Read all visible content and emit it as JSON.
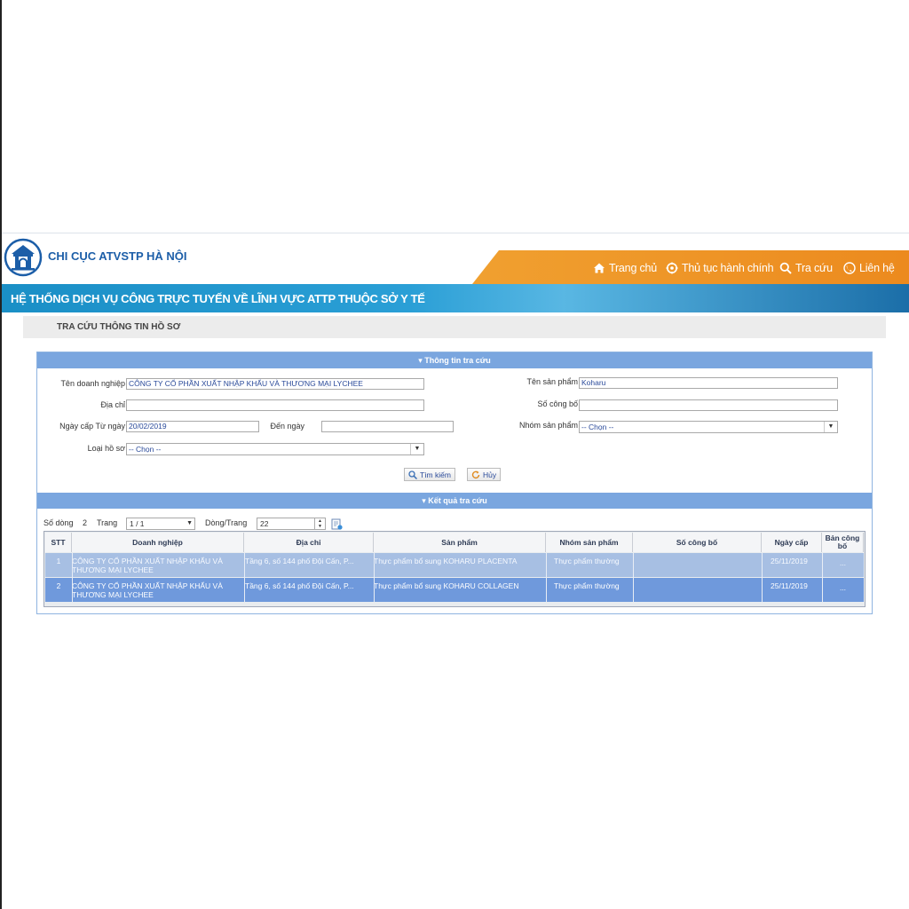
{
  "header": {
    "site_name": "CHI CỤC ATVSTP HÀ NỘI",
    "banner_title": "HỆ THỐNG DỊCH VỤ CÔNG TRỰC TUYẾN VỀ LĨNH VỰC ATTP THUỘC SỞ Y TẾ",
    "nav": [
      {
        "label": "Trang chủ",
        "icon": "home-icon"
      },
      {
        "label": "Thủ tục hành chính",
        "icon": "gear-icon"
      },
      {
        "label": "Tra cứu",
        "icon": "search-icon"
      },
      {
        "label": "Liên hệ",
        "icon": "phone-icon"
      }
    ]
  },
  "page_title": "TRA CỨU THÔNG TIN HỒ SƠ",
  "search": {
    "section_title": "Thông tin tra cứu",
    "company_label": "Tên doanh nghiệp",
    "company_value": "CÔNG TY CỔ PHẦN XUẤT NHẬP KHẨU VÀ THƯƠNG MẠI LYCHEE",
    "address_label": "Địa chỉ",
    "address_value": "",
    "date_from_label": "Ngày cấp Từ ngày",
    "date_from_value": "20/02/2019",
    "date_to_label": "Đến ngày",
    "date_to_value": "",
    "doc_type_label": "Loại hồ sơ",
    "doc_type_value": "-- Chọn --",
    "product_label": "Tên sản phẩm",
    "product_value": "Koharu",
    "announce_no_label": "Số công bố",
    "announce_no_value": "",
    "product_group_label": "Nhóm sản phẩm",
    "product_group_value": "-- Chọn --",
    "search_button": "Tìm kiếm",
    "cancel_button": "Hủy"
  },
  "results": {
    "section_title": "Kết quả tra cứu",
    "row_count_label": "Số dòng",
    "row_count": "2",
    "page_label": "Trang",
    "page_value": "1 / 1",
    "rows_per_page_label": "Dòng/Trang",
    "rows_per_page_value": "22",
    "columns": [
      "STT",
      "Doanh nghiệp",
      "Địa chỉ",
      "Sản phẩm",
      "Nhóm sản phẩm",
      "Số công bố",
      "Ngày cấp",
      "Bản công bố"
    ],
    "rows": [
      {
        "stt": "1",
        "company_line1": "CÔNG TY CỔ PHẦN XUẤT NHẬP KHẨU VÀ",
        "company_line2": "THƯƠNG MẠI LYCHEE",
        "address": "Tầng 6, số 144 phố Đội Cấn, P...",
        "product": "Thực phẩm bổ sung KOHARU PLACENTA",
        "group": "Thực phẩm thường",
        "announce_no": "",
        "date": "25/11/2019",
        "doc": "..."
      },
      {
        "stt": "2",
        "company_line1": "CÔNG TY CỔ PHẦN XUẤT NHẬP KHẨU VÀ",
        "company_line2": "THƯƠNG MẠI LYCHEE",
        "address": "Tầng 6, số 144 phố Đội Cấn, P...",
        "product": "Thực phẩm bổ sung KOHARU COLLAGEN",
        "group": "Thực phẩm thường",
        "announce_no": "",
        "date": "25/11/2019",
        "doc": "..."
      }
    ]
  },
  "colors": {
    "brand_blue": "#1c5ea8",
    "nav_orange": "#ec8a1e",
    "panel_header": "#7aa6df",
    "row_selected": "#6f99dc"
  }
}
